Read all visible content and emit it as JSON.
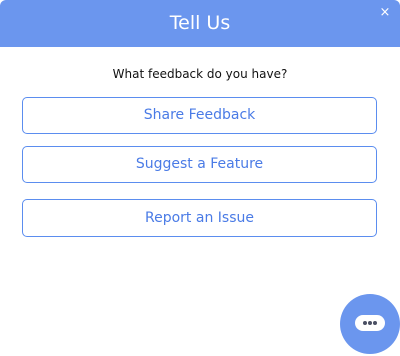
{
  "dialog": {
    "title": "Tell Us",
    "close_label": "×",
    "question": "What feedback do you have?",
    "options": [
      {
        "label": "Share Feedback"
      },
      {
        "label": "Suggest a Feature"
      },
      {
        "label": "Report an Issue"
      }
    ]
  },
  "launcher": {
    "icon": "chat-bubble-icon"
  },
  "colors": {
    "accent": "#6b96ee",
    "button_border": "#5b8def",
    "button_text": "#4a7be6"
  }
}
